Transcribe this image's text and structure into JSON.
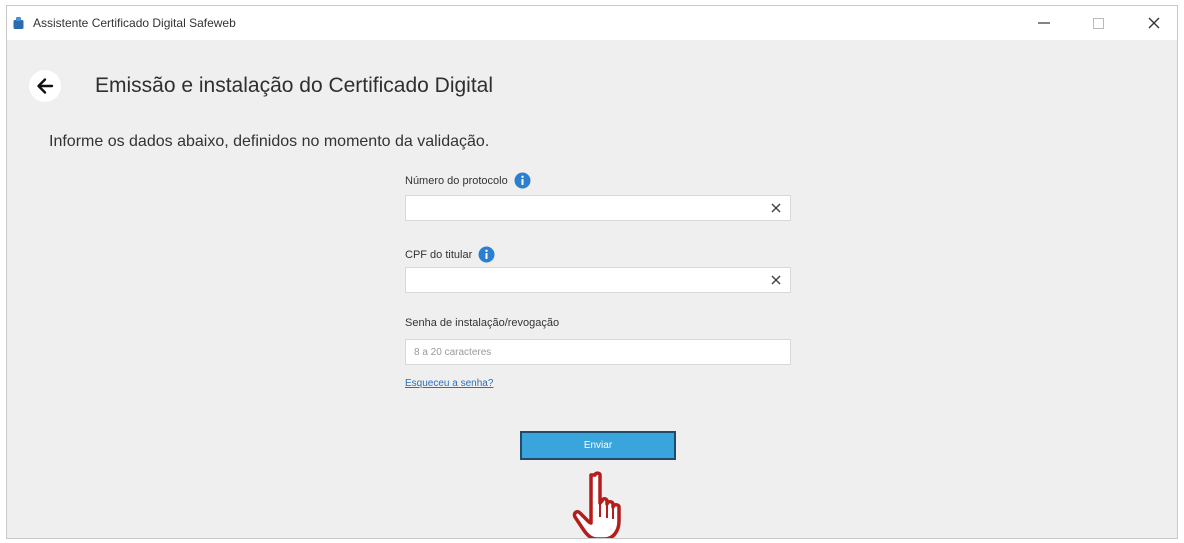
{
  "window": {
    "title": "Assistente Certificado Digital Safeweb",
    "controls": [
      "minimize-icon",
      "maximize-icon",
      "close-icon"
    ]
  },
  "header": {
    "back_icon": "back-arrow-icon",
    "title": "Emissão e instalação do Certificado Digital"
  },
  "instruction": "Informe os dados abaixo, definidos no momento da validação.",
  "form": {
    "protocol": {
      "label": "Número do protocolo",
      "value": "",
      "icon": "info-icon"
    },
    "cpf": {
      "label": "CPF do titular",
      "value": "",
      "icon": "info-icon"
    },
    "password": {
      "label": "Senha de instalação/revogação",
      "placeholder": "8 a 20 caracteres"
    },
    "forgot_link": "Esqueceu a senha?",
    "submit_label": "Enviar"
  },
  "colors": {
    "accent": "#3aa4dc",
    "info": "#2c7fd0",
    "cursor": "#b51c1c"
  }
}
